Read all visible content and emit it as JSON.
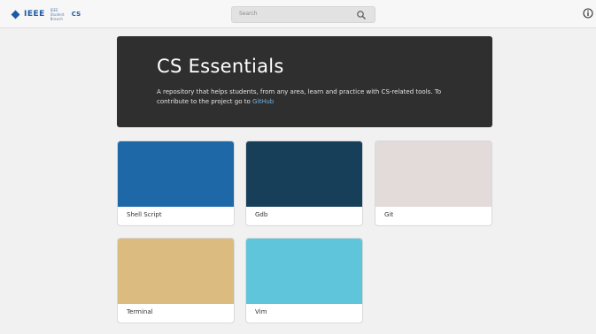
{
  "header": {
    "logo_text": "IEEE",
    "logo_sub": "IEEE Student Branch",
    "logo_cs": "CS",
    "search_placeholder": "Search"
  },
  "hero": {
    "title": "CS Essentials",
    "description": "A repository that helps students, from any area, learn and practice with CS-related tools. To contribute to the project go to ",
    "link_text": "GitHub"
  },
  "cards": [
    {
      "label": "Shell Script",
      "color": "#1e68a8"
    },
    {
      "label": "Gdb",
      "color": "#183f5a"
    },
    {
      "label": "Git",
      "color": "#e3dada"
    },
    {
      "label": "Terminal",
      "color": "#dbbb80"
    },
    {
      "label": "Vim",
      "color": "#5fc5db"
    }
  ],
  "colors": {
    "brand": "#1a5aa6",
    "hero_bg": "#2f2f2f",
    "link": "#6fb3e6"
  }
}
